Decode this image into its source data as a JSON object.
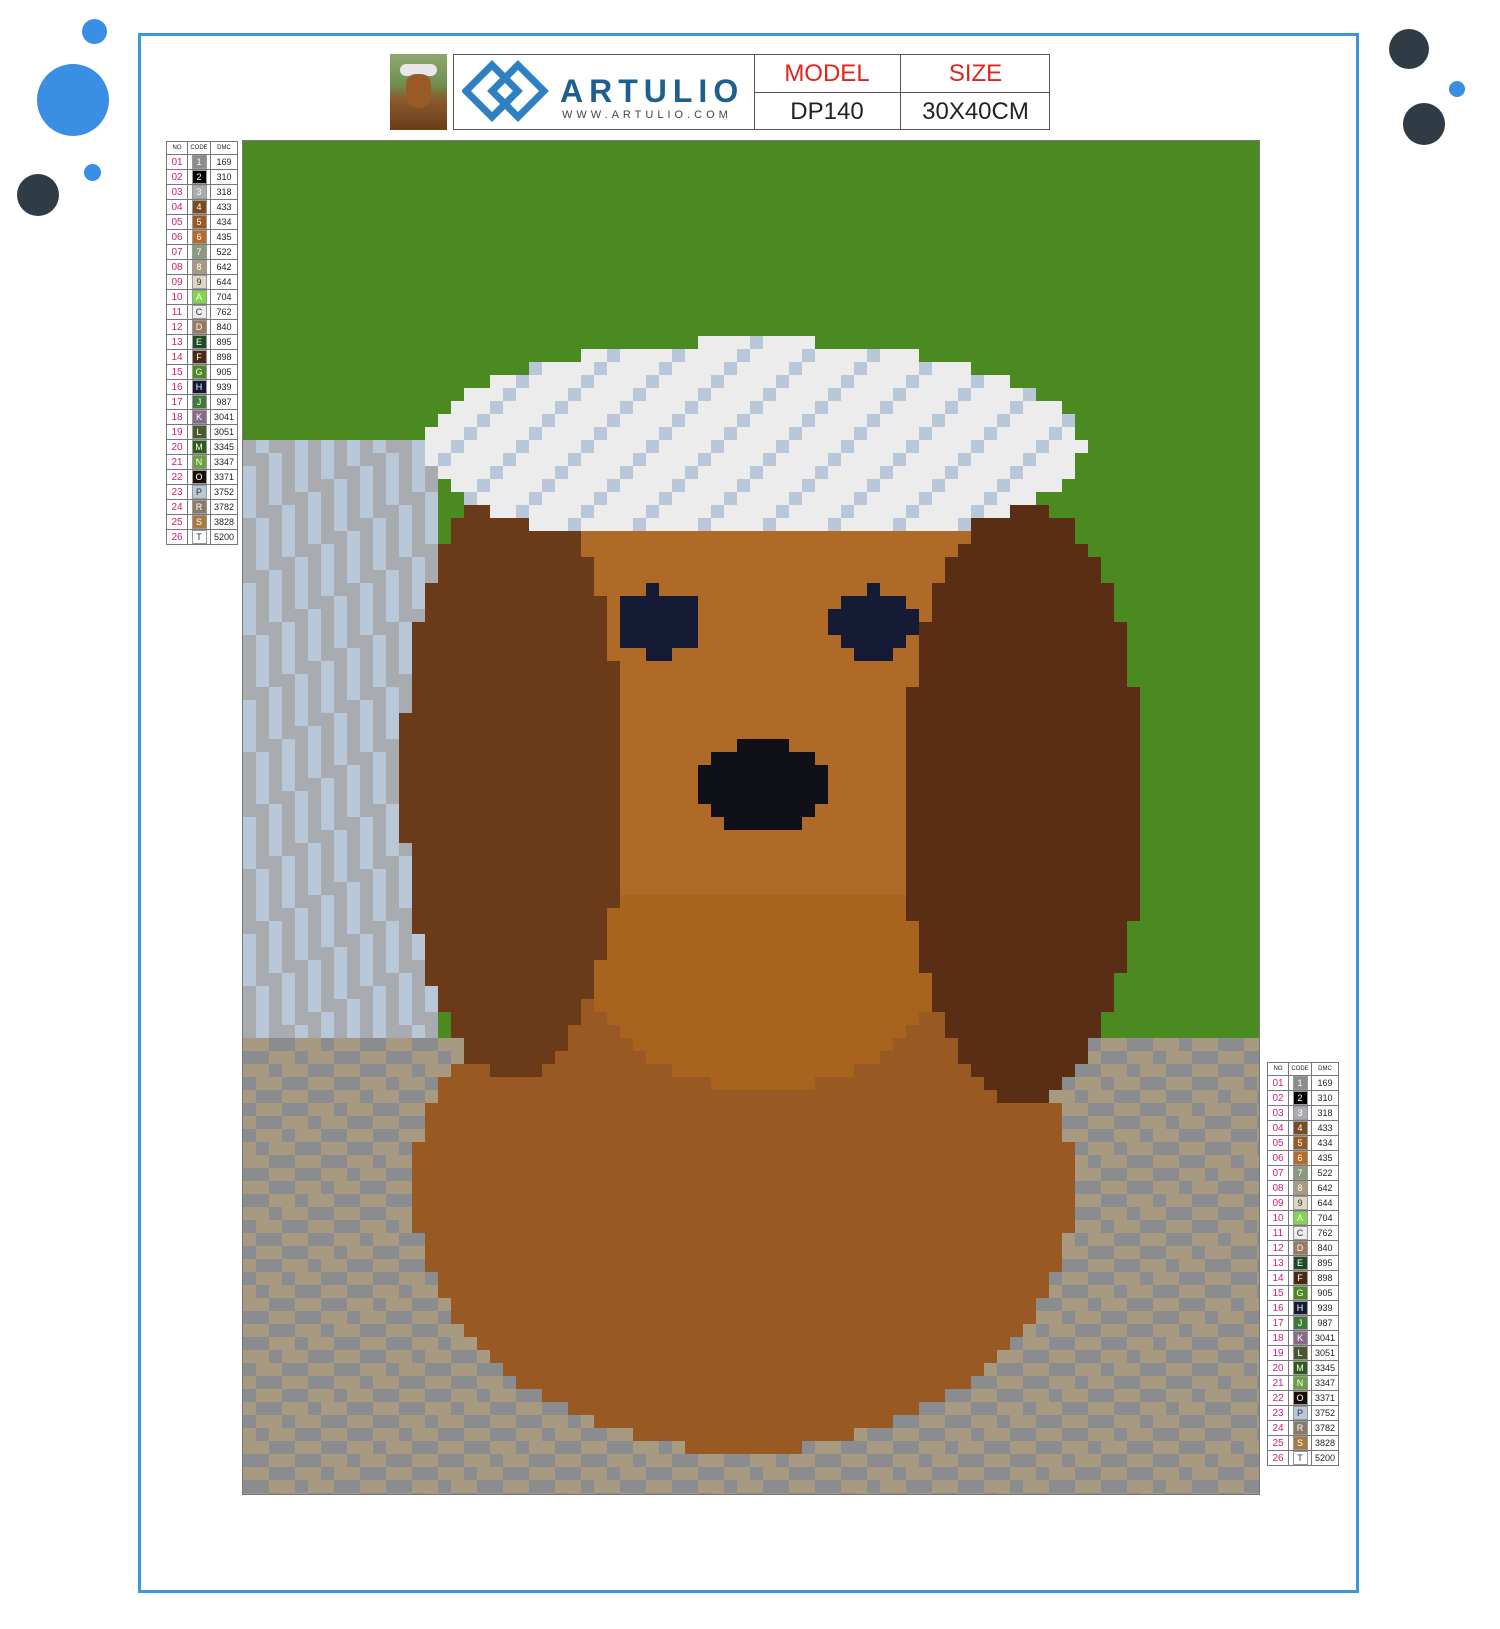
{
  "decorations": {
    "dots": [
      {
        "color": "#3a8ee3",
        "name": "blue-dot-large"
      },
      {
        "color": "#3a8ee3",
        "name": "blue-dot-small-top"
      },
      {
        "color": "#3a8ee3",
        "name": "blue-dot-small-mid"
      },
      {
        "color": "#2f3b45",
        "name": "dark-dot-left"
      },
      {
        "color": "#2f3b45",
        "name": "dark-dot-right-top"
      },
      {
        "color": "#2f3b45",
        "name": "dark-dot-right-bottom"
      },
      {
        "color": "#3a8ee3",
        "name": "blue-dot-right"
      }
    ],
    "accent_color": "#3f98d6"
  },
  "header": {
    "brand": "ARTULIO",
    "url": "WWW.ARTULIO.COM",
    "model_label": "MODEL",
    "model_value": "DP140",
    "size_label": "SIZE",
    "size_value": "30X40CM",
    "label_color": "#e0231c"
  },
  "legend": {
    "col_no": "NO",
    "col_code": "CODE",
    "col_dmc": "DMC",
    "rows": [
      {
        "no": "01",
        "code": "1",
        "dmc": "169",
        "bg": "#8a8c8f",
        "fg": "#ffffff"
      },
      {
        "no": "02",
        "code": "2",
        "dmc": "310",
        "bg": "#000000",
        "fg": "#ffffff"
      },
      {
        "no": "03",
        "code": "3",
        "dmc": "318",
        "bg": "#a8abb0",
        "fg": "#ffffff"
      },
      {
        "no": "04",
        "code": "4",
        "dmc": "433",
        "bg": "#7a4a20",
        "fg": "#ffffff"
      },
      {
        "no": "05",
        "code": "5",
        "dmc": "434",
        "bg": "#985a22",
        "fg": "#ffffff"
      },
      {
        "no": "06",
        "code": "6",
        "dmc": "435",
        "bg": "#b86a2a",
        "fg": "#ffffff"
      },
      {
        "no": "07",
        "code": "7",
        "dmc": "522",
        "bg": "#8a9a7c",
        "fg": "#ffffff"
      },
      {
        "no": "08",
        "code": "8",
        "dmc": "642",
        "bg": "#a89a80",
        "fg": "#ffffff"
      },
      {
        "no": "09",
        "code": "9",
        "dmc": "644",
        "bg": "#ddd6c0",
        "fg": "#333333"
      },
      {
        "no": "10",
        "code": "A",
        "dmc": "704",
        "bg": "#7ed84a",
        "fg": "#ffffff"
      },
      {
        "no": "11",
        "code": "C",
        "dmc": "762",
        "bg": "#ececec",
        "fg": "#333333"
      },
      {
        "no": "12",
        "code": "D",
        "dmc": "840",
        "bg": "#9a7a5c",
        "fg": "#ffffff"
      },
      {
        "no": "13",
        "code": "E",
        "dmc": "895",
        "bg": "#1f4a26",
        "fg": "#ffffff"
      },
      {
        "no": "14",
        "code": "F",
        "dmc": "898",
        "bg": "#4a2a12",
        "fg": "#ffffff"
      },
      {
        "no": "15",
        "code": "G",
        "dmc": "905",
        "bg": "#4a8a20",
        "fg": "#ffffff"
      },
      {
        "no": "16",
        "code": "H",
        "dmc": "939",
        "bg": "#151a35",
        "fg": "#ffffff"
      },
      {
        "no": "17",
        "code": "J",
        "dmc": "987",
        "bg": "#3e7a3a",
        "fg": "#ffffff"
      },
      {
        "no": "18",
        "code": "K",
        "dmc": "3041",
        "bg": "#8a6a8a",
        "fg": "#ffffff"
      },
      {
        "no": "19",
        "code": "L",
        "dmc": "3051",
        "bg": "#4a5a30",
        "fg": "#ffffff"
      },
      {
        "no": "20",
        "code": "M",
        "dmc": "3345",
        "bg": "#2e5a1a",
        "fg": "#ffffff"
      },
      {
        "no": "21",
        "code": "N",
        "dmc": "3347",
        "bg": "#6aa040",
        "fg": "#ffffff"
      },
      {
        "no": "22",
        "code": "O",
        "dmc": "3371",
        "bg": "#1a0e08",
        "fg": "#ffffff"
      },
      {
        "no": "23",
        "code": "P",
        "dmc": "3752",
        "bg": "#b8c8d8",
        "fg": "#333333"
      },
      {
        "no": "24",
        "code": "R",
        "dmc": "3782",
        "bg": "#8a7a68",
        "fg": "#ffffff"
      },
      {
        "no": "25",
        "code": "S",
        "dmc": "3828",
        "bg": "#a87a40",
        "fg": "#ffffff"
      },
      {
        "no": "26",
        "code": "T",
        "dmc": "5200",
        "bg": "#ffffff",
        "fg": "#333333"
      }
    ]
  }
}
